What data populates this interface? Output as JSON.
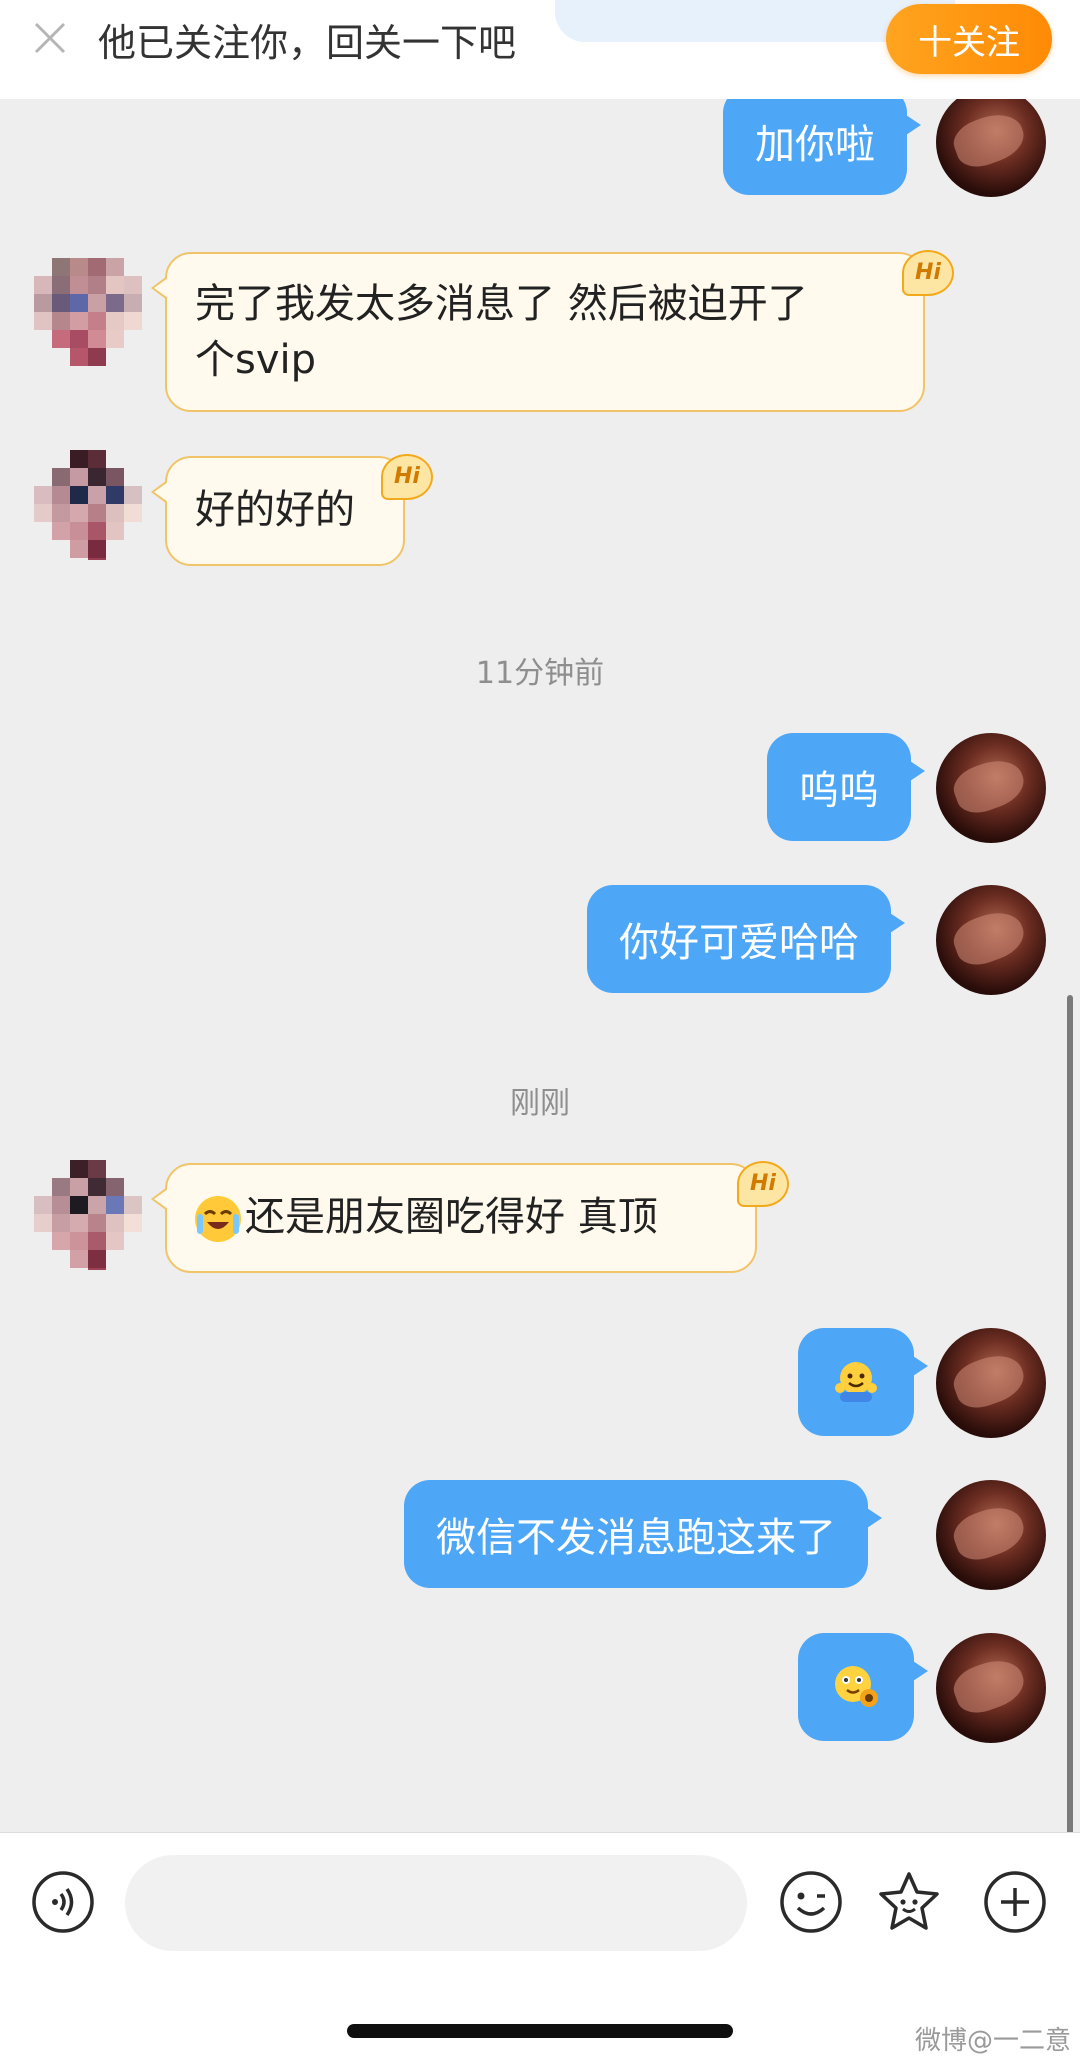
{
  "banner": {
    "text": "他已关注你，回关一下吧",
    "follow_label": "十关注"
  },
  "messages": [
    {
      "side": "me",
      "text": "加你啦"
    },
    {
      "side": "other",
      "text_line1": "完了我发太多消息了 然后被迫开了",
      "text_line2": "个svip",
      "badge": "Hi"
    },
    {
      "side": "other",
      "text": "好的好的",
      "badge": "Hi"
    },
    {
      "side": "time",
      "text": "11分钟前"
    },
    {
      "side": "me",
      "text": "呜呜"
    },
    {
      "side": "me",
      "text": "你好可爱哈哈"
    },
    {
      "side": "time",
      "text": "刚刚"
    },
    {
      "side": "other",
      "text": "还是朋友圈吃得好  真顶",
      "badge": "Hi",
      "emoji": "laugh-cry-emoji"
    },
    {
      "side": "me",
      "emoji": "hug-emoji"
    },
    {
      "side": "me",
      "text": "微信不发消息跑这来了"
    },
    {
      "side": "me",
      "emoji": "sunflower-emoji"
    }
  ],
  "input": {
    "placeholder": "",
    "icons": [
      "voice-icon",
      "emoji-icon",
      "sticker-icon",
      "plus-icon"
    ]
  },
  "watermark": "微博@一二意",
  "colors": {
    "my_bubble": "#4ea7f6",
    "other_bubble": "#fffaed",
    "follow_button": "#ff9a12"
  }
}
